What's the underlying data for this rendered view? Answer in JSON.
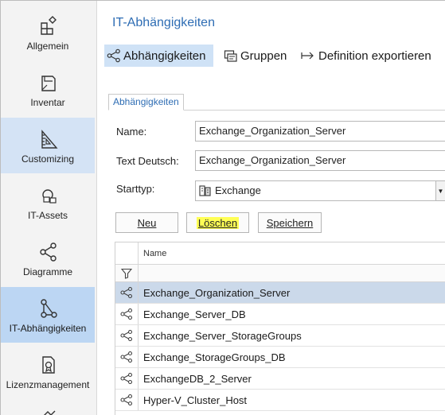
{
  "page": {
    "title": "IT-Abhängigkeiten"
  },
  "sidebar": {
    "items": [
      {
        "label": "Allgemein",
        "icon": "puzzle-icon"
      },
      {
        "label": "Inventar",
        "icon": "folder-icon"
      },
      {
        "label": "Customizing",
        "icon": "ruler-icon"
      },
      {
        "label": "IT-Assets",
        "icon": "network-icon"
      },
      {
        "label": "Diagramme",
        "icon": "share-icon"
      },
      {
        "label": "IT-Abhängigkeiten",
        "icon": "dependency-icon"
      },
      {
        "label": "Lizenzmanagement",
        "icon": "license-icon"
      }
    ],
    "active_index": 5
  },
  "toolbar": {
    "dependencies_label": "Abhängigkeiten",
    "groups_label": "Gruppen",
    "export_label": "Definition exportieren"
  },
  "tab": {
    "label": "Abhängigkeiten"
  },
  "form": {
    "name_label": "Name:",
    "name_value": "Exchange_Organization_Server",
    "text_label": "Text Deutsch:",
    "text_value": "Exchange_Organization_Server",
    "starttyp_label": "Starttyp:",
    "starttyp_value": "Exchange"
  },
  "buttons": {
    "new_label": "Neu",
    "delete_label": "Löschen",
    "save_label": "Speichern"
  },
  "grid": {
    "column_name": "Name",
    "rows": [
      "Exchange_Organization_Server",
      "Exchange_Server_DB",
      "Exchange_Server_StorageGroups",
      "Exchange_StorageGroups_DB",
      "ExchangeDB_2_Server",
      "Hyper-V_Cluster_Host"
    ],
    "selected_index": 0
  },
  "colors": {
    "accent": "#2e6db4",
    "active_nav": "#bcd6f3",
    "highlight": "#ffff55",
    "selected_row": "#cbd9ea"
  }
}
